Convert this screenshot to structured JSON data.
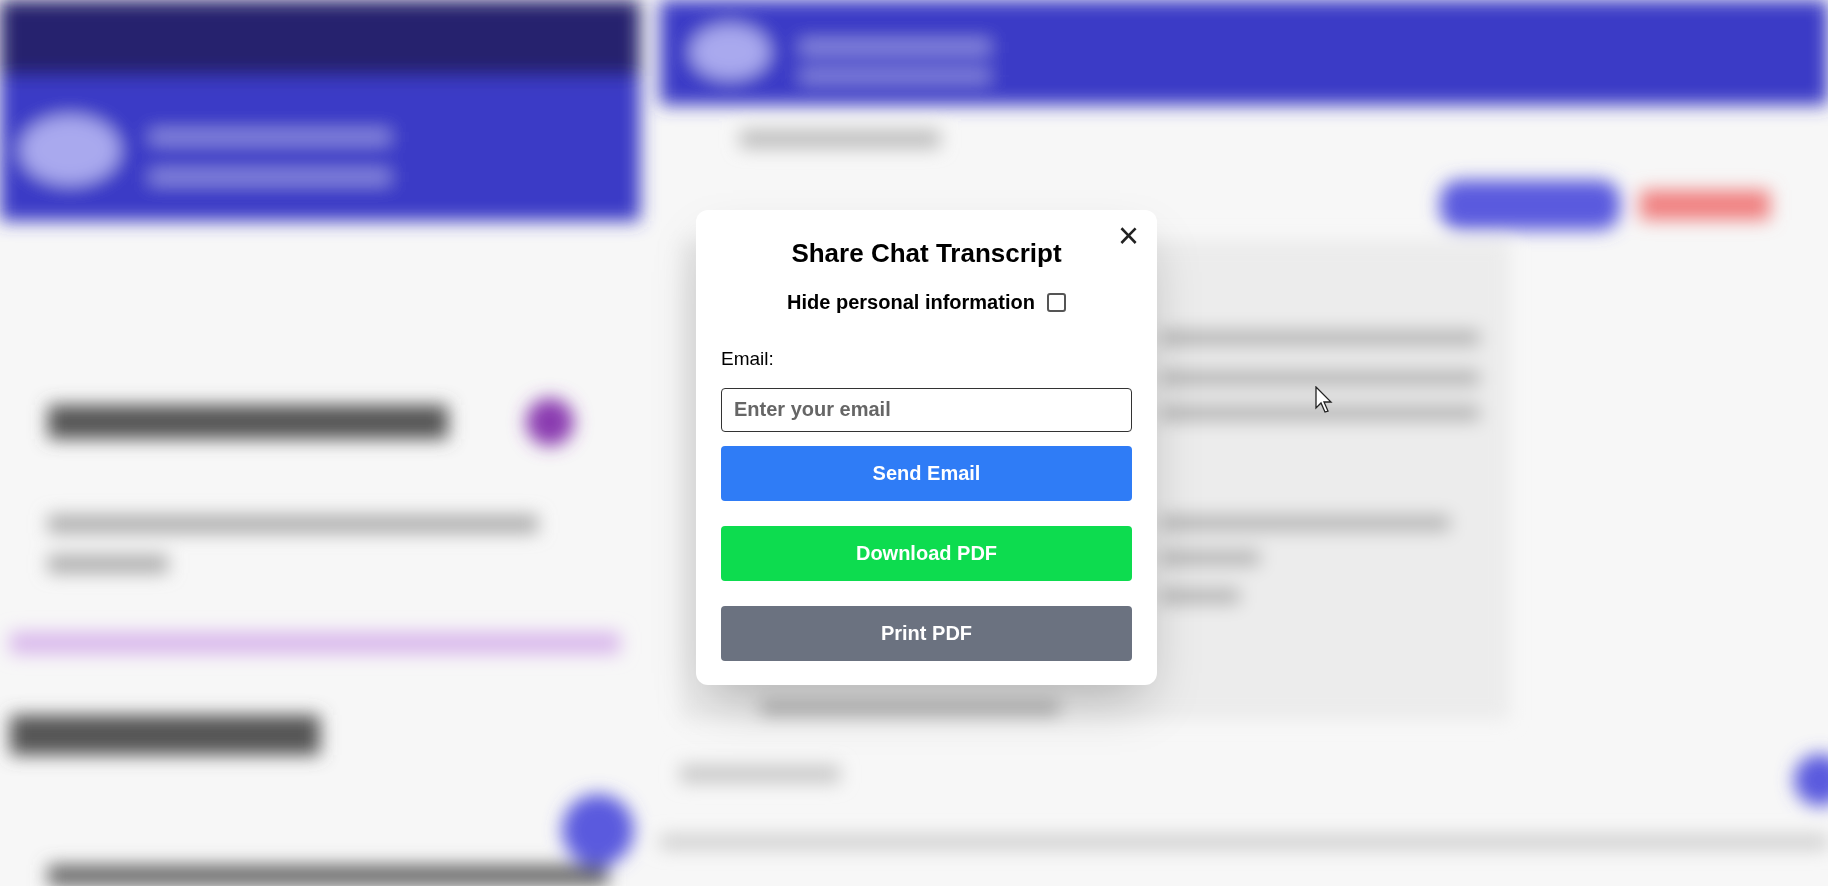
{
  "dialog": {
    "title": "Share Chat Transcript",
    "close": "×",
    "hide_personal": {
      "label": "Hide personal information",
      "checked": false
    },
    "email": {
      "label": "Email:",
      "placeholder": "Enter your email"
    },
    "buttons": [
      {
        "label": "Send Email",
        "color": "#2f7cf6"
      },
      {
        "label": "Download PDF",
        "color": "#0ddc4f"
      },
      {
        "label": "Print PDF",
        "color": "#6b7280"
      }
    ]
  }
}
